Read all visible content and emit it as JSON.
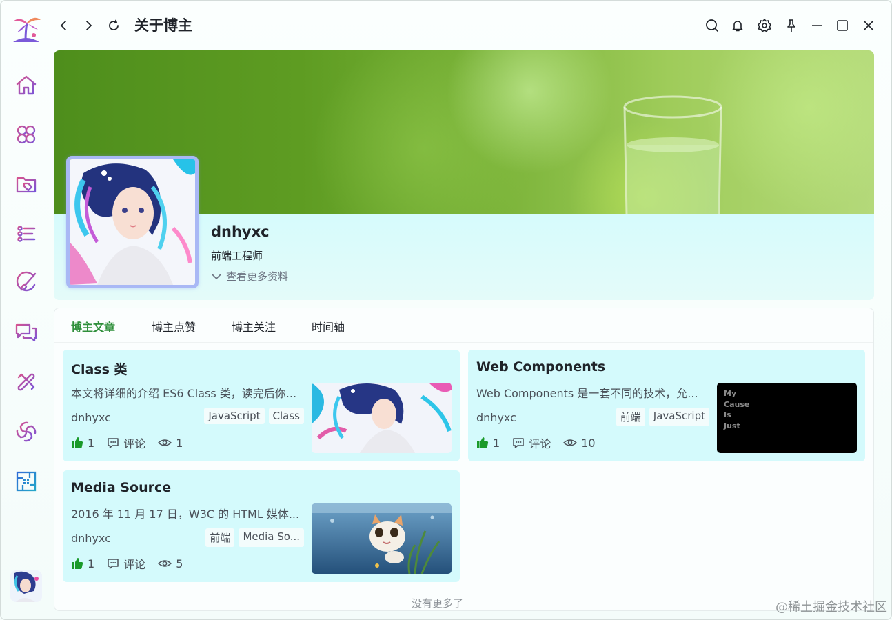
{
  "window": {
    "title": "关于博主"
  },
  "sidebar": {
    "items": [
      {
        "icon": "home-icon"
      },
      {
        "icon": "apps-icon"
      },
      {
        "icon": "tag-folder-icon"
      },
      {
        "icon": "list-icon"
      },
      {
        "icon": "brush-icon"
      },
      {
        "icon": "chat-icon"
      },
      {
        "icon": "tools-icon"
      },
      {
        "icon": "spiral-icon"
      },
      {
        "icon": "grid-icon"
      }
    ],
    "accent": "#9a5bd6"
  },
  "profile": {
    "name": "dnhyxc",
    "role": "前端工程师",
    "more_label": "查看更多资料"
  },
  "tabs": [
    {
      "label": "博主文章",
      "active": true
    },
    {
      "label": "博主点赞",
      "active": false
    },
    {
      "label": "博主关注",
      "active": false
    },
    {
      "label": "时间轴",
      "active": false
    }
  ],
  "articles": [
    {
      "title": "Class 类",
      "desc": "本文将详细的介绍 ES6 Class 类，读完后你...",
      "author": "dnhyxc",
      "tags": [
        "JavaScript",
        "Class"
      ],
      "likes": "1",
      "comment_label": "评论",
      "views": "1"
    },
    {
      "title": "Web Components",
      "desc": "Web Components 是一套不同的技术，允...",
      "author": "dnhyxc",
      "tags": [
        "前端",
        "JavaScript"
      ],
      "likes": "1",
      "comment_label": "评论",
      "views": "10",
      "thumb_text": "My\nCause\nIs\nJust"
    },
    {
      "title": "Media Source",
      "desc": "2016 年 11 月 17 日，W3C 的 HTML 媒体...",
      "author": "dnhyxc",
      "tags": [
        "前端",
        "Media So..."
      ],
      "likes": "1",
      "comment_label": "评论",
      "views": "5"
    }
  ],
  "footer_note": "没有更多了",
  "watermark": "@稀土掘金技术社区",
  "colors": {
    "active_tab": "#2f8f3b",
    "like": "#1a9a2a",
    "card_bg": "#d4fafc"
  }
}
